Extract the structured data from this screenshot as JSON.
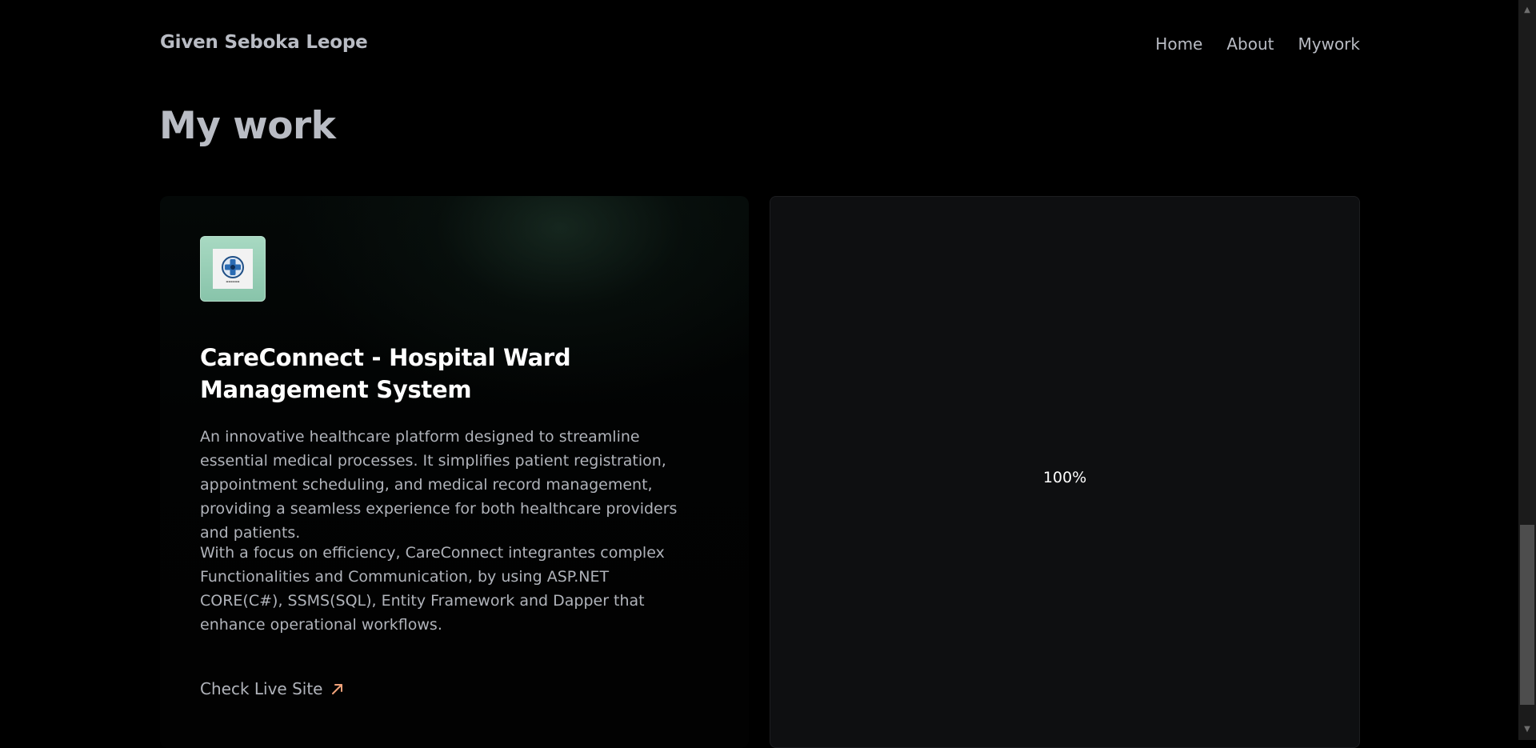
{
  "header": {
    "brand": "Given Seboka Leope",
    "nav": [
      {
        "label": "Home"
      },
      {
        "label": "About"
      },
      {
        "label": "Mywork"
      }
    ]
  },
  "main": {
    "title": "My work",
    "project": {
      "logo_icon": "careconnect-logo-icon",
      "title": "CareConnect - Hospital Ward Management System",
      "description_1": "An innovative healthcare platform designed to streamline essential medical processes. It simplifies patient registration, appointment scheduling, and medical record management, providing a seamless experience for both healthcare providers and patients.",
      "description_2": "With a focus on efficiency, CareConnect integrantes complex Functionalities and Communication, by using ASP.NET CORE(C#), SSMS(SQL), Entity Framework and Dapper that enhance operational workflows.",
      "link_label": "Check Live Site",
      "link_icon": "arrow-up-right-icon"
    },
    "preview": {
      "zoom_label": "100%"
    }
  },
  "colors": {
    "background": "#000000",
    "text_muted": "#b9bcc4",
    "accent_arrow": "#f0a27a",
    "preview_bg": "#0e0f11"
  }
}
